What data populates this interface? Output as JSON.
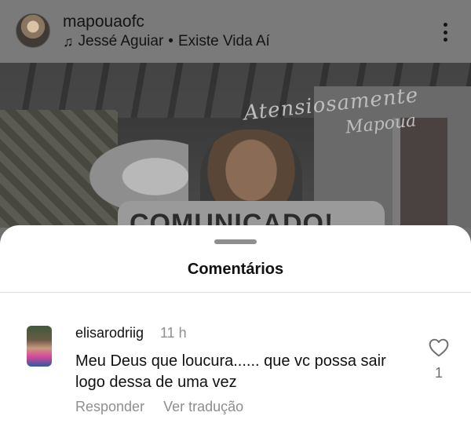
{
  "post": {
    "username": "mapouaofc",
    "music": {
      "artist": "Jessé Aguiar",
      "separator": "•",
      "track": "Existe Vida Aí"
    },
    "image": {
      "watermark_line1": "Atensiosamente",
      "watermark_line2": "Mapoua",
      "banner_text": "COMUNICADO!"
    }
  },
  "comments_sheet": {
    "title": "Comentários",
    "comments": [
      {
        "username": "elisarodriig",
        "time": "11 h",
        "text": "Meu Deus que loucura...... que vc possa sair logo dessa de uma vez",
        "likes": "1",
        "reply_label": "Responder",
        "translate_label": "Ver tradução"
      }
    ]
  },
  "icons": {
    "music": "music-note-icon",
    "more": "more-vertical-icon",
    "like": "heart-outline-icon"
  }
}
